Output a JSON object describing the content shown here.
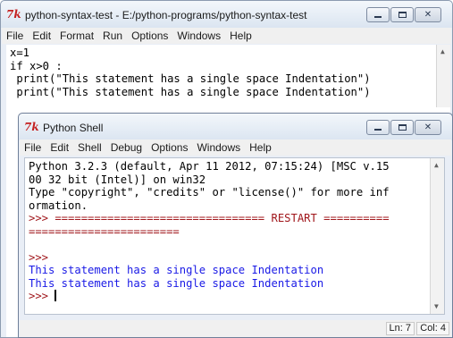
{
  "editor": {
    "title": "python-syntax-test - E:/python-programs/python-syntax-test",
    "menu": [
      "File",
      "Edit",
      "Format",
      "Run",
      "Options",
      "Windows",
      "Help"
    ],
    "code_lines": [
      "x=1",
      "if x>0 :",
      " print(\"This statement has a single space Indentation\")",
      " print(\"This statement has a single space Indentation\")"
    ]
  },
  "shell": {
    "title": "Python Shell",
    "menu": [
      "File",
      "Edit",
      "Shell",
      "Debug",
      "Options",
      "Windows",
      "Help"
    ],
    "banner_lines": [
      "Python 3.2.3 (default, Apr 11 2012, 07:15:24) [MSC v.15",
      "00 32 bit (Intel)] on win32",
      "Type \"copyright\", \"credits\" or \"license()\" for more inf",
      "ormation."
    ],
    "restart_lines": [
      ">>> ================================ RESTART ==========",
      "======================="
    ],
    "prompt": ">>>",
    "output_lines": [
      "This statement has a single space Indentation",
      "This statement has a single space Indentation"
    ],
    "status": {
      "line": "Ln: 7",
      "col": "Col: 4"
    }
  }
}
